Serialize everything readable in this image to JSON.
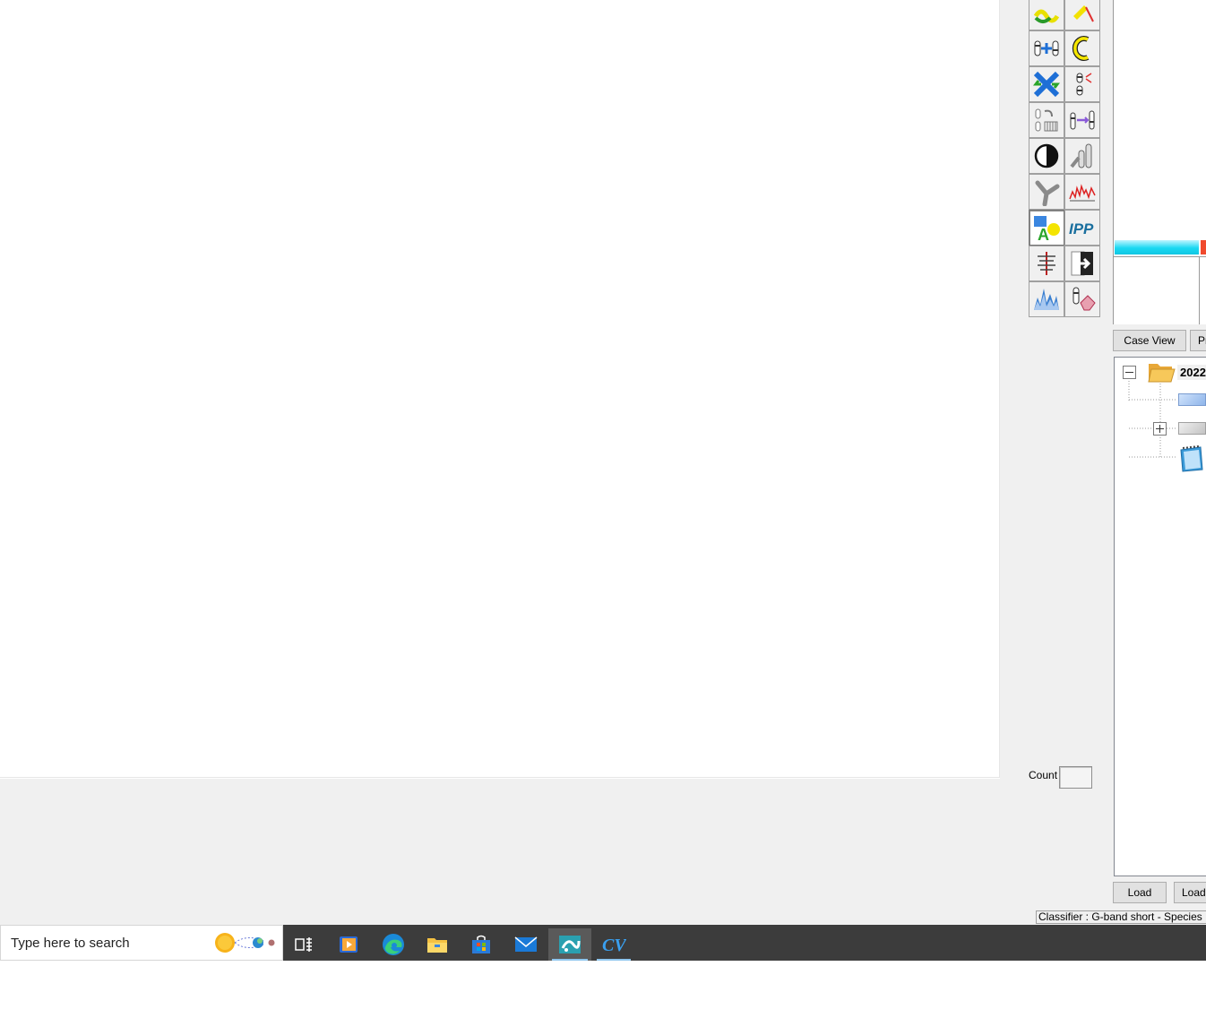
{
  "tools": [
    {
      "name": "chromosome-link-tool-icon",
      "interactive": true
    },
    {
      "name": "yellow-pointer-tool-icon",
      "interactive": true
    },
    {
      "name": "chromosome-add-tool-icon",
      "interactive": true
    },
    {
      "name": "centromere-c-tool-icon",
      "interactive": true
    },
    {
      "name": "chromosome-cross-tool-icon",
      "interactive": true
    },
    {
      "name": "chromosome-split-tool-icon",
      "interactive": true
    },
    {
      "name": "karyogram-arrange-tool-icon",
      "interactive": true
    },
    {
      "name": "chromosome-swap-tool-icon",
      "interactive": true
    },
    {
      "name": "contrast-tool-icon",
      "interactive": true
    },
    {
      "name": "chromosome-pair-tool-icon",
      "interactive": true
    },
    {
      "name": "branch-separate-tool-icon",
      "interactive": true
    },
    {
      "name": "profile-graph-tool-icon",
      "interactive": true
    },
    {
      "name": "annotate-shapes-tool-icon",
      "interactive": true,
      "active": true
    },
    {
      "name": "ipp-tool-icon",
      "interactive": true,
      "label": "IPP"
    },
    {
      "name": "axis-straighten-tool-icon",
      "interactive": true
    },
    {
      "name": "export-arrow-tool-icon",
      "interactive": true
    },
    {
      "name": "histogram-tool-icon",
      "interactive": true
    },
    {
      "name": "chromosome-erase-tool-icon",
      "interactive": true
    }
  ],
  "count": {
    "label": "Count",
    "value": ""
  },
  "tabs": {
    "case_view": "Case View",
    "second": "Pr"
  },
  "tree": {
    "root_label": "2022"
  },
  "buttons": {
    "load1": "Load",
    "load2": "Load"
  },
  "status": {
    "text": "Classifier : G-band short - Species : H"
  },
  "taskbar": {
    "search_placeholder": "Type here to search",
    "apps": [
      "task-view-icon",
      "media-player-icon",
      "edge-icon",
      "file-explorer-icon",
      "store-icon",
      "mail-icon",
      "cytovision-icon",
      "cv-app-icon"
    ]
  },
  "colors": {
    "accent_cyan": "#1ad8f2",
    "accent_red": "#f04a2e",
    "taskbar": "#3c3c3c"
  }
}
